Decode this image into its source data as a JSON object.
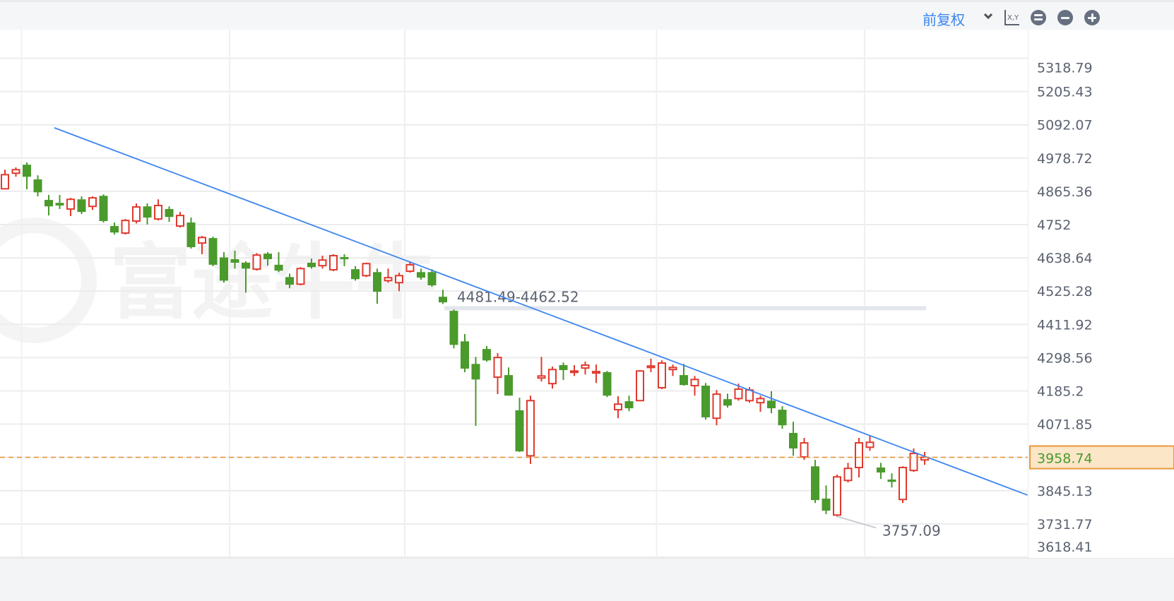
{
  "toolbar": {
    "adjust_label": "前复权",
    "icons": [
      "chevron-down-icon",
      "xy-axis-icon",
      "equal-circle-icon",
      "minus-circle-icon",
      "plus-circle-icon"
    ],
    "axis_icon_text": "X,Y"
  },
  "watermark": "富途牛牛",
  "colors": {
    "up": "#e03a2e",
    "down": "#4a9a2c",
    "trendline": "#3d86f0",
    "last_price": "#e8983a",
    "last_badge_bg": "#fbe6c8",
    "grid": "#ececee"
  },
  "chart_data": {
    "type": "candlestick",
    "y_axis": {
      "position": "right",
      "range": [
        3618.41,
        5318.79
      ],
      "ticks": [
        5318.79,
        5205.43,
        5092.07,
        4978.72,
        4865.36,
        4752.0,
        4638.64,
        4525.28,
        4411.92,
        4298.56,
        4185.2,
        4071.85,
        3958.74,
        3845.13,
        3731.77,
        3618.41
      ]
    },
    "grid": true,
    "period_boundaries": [
      2,
      21,
      37,
      60,
      79
    ],
    "candles": [
      [
        4874,
        4939,
        4872,
        4922
      ],
      [
        4927,
        4947,
        4915,
        4939
      ],
      [
        4956,
        4964,
        4872,
        4915
      ],
      [
        4906,
        4920,
        4848,
        4862
      ],
      [
        4836,
        4853,
        4783,
        4814
      ],
      [
        4826,
        4853,
        4805,
        4817
      ],
      [
        4805,
        4843,
        4781,
        4838
      ],
      [
        4838,
        4848,
        4788,
        4795
      ],
      [
        4814,
        4848,
        4802,
        4843
      ],
      [
        4850,
        4855,
        4759,
        4764
      ],
      [
        4747,
        4759,
        4718,
        4725
      ],
      [
        4723,
        4771,
        4718,
        4766
      ],
      [
        4764,
        4824,
        4756,
        4812
      ],
      [
        4814,
        4824,
        4752,
        4776
      ],
      [
        4771,
        4838,
        4766,
        4817
      ],
      [
        4805,
        4814,
        4761,
        4778
      ],
      [
        4747,
        4795,
        4742,
        4783
      ],
      [
        4759,
        4776,
        4670,
        4675
      ],
      [
        4689,
        4713,
        4651,
        4708
      ],
      [
        4706,
        4711,
        4610,
        4615
      ],
      [
        4640,
        4658,
        4554,
        4561
      ],
      [
        4634,
        4663,
        4602,
        4622
      ],
      [
        4622,
        4627,
        4520,
        4602
      ],
      [
        4600,
        4655,
        4595,
        4648
      ],
      [
        4653,
        4658,
        4612,
        4634
      ],
      [
        4615,
        4658,
        4590,
        4595
      ],
      [
        4573,
        4585,
        4535,
        4547
      ],
      [
        4549,
        4607,
        4545,
        4602
      ],
      [
        4622,
        4636,
        4602,
        4607
      ],
      [
        4612,
        4646,
        4602,
        4631
      ],
      [
        4598,
        4651,
        4593,
        4646
      ],
      [
        4641,
        4651,
        4610,
        4634
      ],
      [
        4600,
        4610,
        4561,
        4566
      ],
      [
        4578,
        4622,
        4573,
        4619
      ],
      [
        4590,
        4602,
        4482,
        4523
      ],
      [
        4561,
        4602,
        4554,
        4571
      ],
      [
        4554,
        4588,
        4525,
        4578
      ],
      [
        4593,
        4627,
        4588,
        4615
      ],
      [
        4590,
        4602,
        4564,
        4571
      ],
      [
        4590,
        4600,
        4540,
        4545
      ],
      [
        4506,
        4530,
        4481.49,
        4487
      ],
      [
        4458,
        4462.52,
        4330,
        4342
      ],
      [
        4354,
        4379,
        4249,
        4261
      ],
      [
        4277,
        4301,
        4066,
        4224
      ],
      [
        4328,
        4338,
        4285,
        4289
      ],
      [
        4232,
        4314,
        4174,
        4299
      ],
      [
        4239,
        4265,
        4169,
        4169
      ],
      [
        4119,
        4162,
        3977,
        3979
      ],
      [
        3964,
        4169,
        3936,
        4152
      ],
      [
        4229,
        4301,
        4217,
        4236
      ],
      [
        4210,
        4268,
        4193,
        4258
      ],
      [
        4273,
        4282,
        4222,
        4256
      ],
      [
        4249,
        4273,
        4236,
        4253
      ],
      [
        4263,
        4285,
        4241,
        4273
      ],
      [
        4246,
        4275,
        4212,
        4251
      ],
      [
        4249,
        4253,
        4164,
        4169
      ],
      [
        4121,
        4167,
        4092,
        4140
      ],
      [
        4150,
        4169,
        4116,
        4126
      ],
      [
        4152,
        4256,
        4150,
        4253
      ],
      [
        4265,
        4295,
        4249,
        4270
      ],
      [
        4196,
        4289,
        4191,
        4280
      ],
      [
        4258,
        4275,
        4236,
        4265
      ],
      [
        4239,
        4277,
        4203,
        4205
      ],
      [
        4203,
        4236,
        4169,
        4224
      ],
      [
        4203,
        4212,
        4087,
        4095
      ],
      [
        4092,
        4188,
        4068,
        4174
      ],
      [
        4157,
        4176,
        4128,
        4135
      ],
      [
        4159,
        4210,
        4152,
        4191
      ],
      [
        4152,
        4198,
        4145,
        4188
      ],
      [
        4145,
        4169,
        4114,
        4159
      ],
      [
        4152,
        4184,
        4109,
        4126
      ],
      [
        4121,
        4133,
        4056,
        4068
      ],
      [
        4042,
        4080,
        3964,
        3989
      ],
      [
        3960,
        4025,
        3950,
        4008
      ],
      [
        3928,
        3950,
        3803,
        3813
      ],
      [
        3818,
        3863,
        3765,
        3777
      ],
      [
        3762,
        3900,
        3757.09,
        3892
      ],
      [
        3880,
        3940,
        3873,
        3921
      ],
      [
        3924,
        4025,
        3890,
        4008
      ],
      [
        3993,
        4032,
        3981,
        4010
      ],
      [
        3924,
        3940,
        3885,
        3907
      ],
      [
        3883,
        3904,
        3856,
        3875
      ],
      [
        3815,
        3928,
        3803,
        3924
      ],
      [
        3914,
        3989,
        3909,
        3972
      ],
      [
        3950,
        3977,
        3933,
        3958.74
      ]
    ],
    "last_price": 3958.74,
    "last_price_label": "3958.74",
    "trendline": {
      "from": [
        4.5,
        5082
      ],
      "to": [
        93.4,
        3830
      ]
    },
    "gap_annotation": {
      "label": "4481.49-4462.52",
      "from_index": 40,
      "to_index": 84,
      "price": 4467
    },
    "low_annotation": {
      "label": "3757.09",
      "index": 76,
      "price": 3757.09
    }
  }
}
